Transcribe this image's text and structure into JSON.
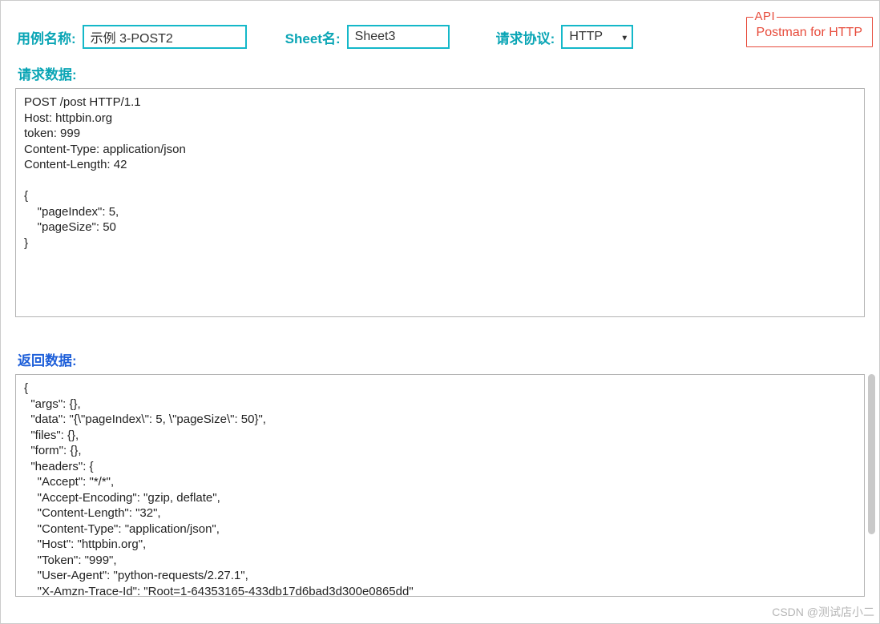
{
  "topRow": {
    "caseNameLabel": "用例名称:",
    "caseNameValue": "示例 3-POST2",
    "sheetLabel": "Sheet名:",
    "sheetValue": "Sheet3",
    "protocolLabel": "请求协议:",
    "protocolValue": "HTTP"
  },
  "apiBox": {
    "legend": "API",
    "text": "Postman for HTTP"
  },
  "sections": {
    "requestLabel": "请求数据:",
    "responseLabel": "返回数据:"
  },
  "requestData": "POST /post HTTP/1.1\nHost: httpbin.org\ntoken: 999\nContent-Type: application/json\nContent-Length: 42\n\n{\n    \"pageIndex\": 5,\n    \"pageSize\": 50\n}",
  "responseData": "{\n  \"args\": {},\n  \"data\": \"{\\\"pageIndex\\\": 5, \\\"pageSize\\\": 50}\",\n  \"files\": {},\n  \"form\": {},\n  \"headers\": {\n    \"Accept\": \"*/*\",\n    \"Accept-Encoding\": \"gzip, deflate\",\n    \"Content-Length\": \"32\",\n    \"Content-Type\": \"application/json\",\n    \"Host\": \"httpbin.org\",\n    \"Token\": \"999\",\n    \"User-Agent\": \"python-requests/2.27.1\",\n    \"X-Amzn-Trace-Id\": \"Root=1-64353165-433db17d6bad3d300e0865dd\"\n  },\n  \"json\": {",
  "watermark": "CSDN @测试店小二"
}
